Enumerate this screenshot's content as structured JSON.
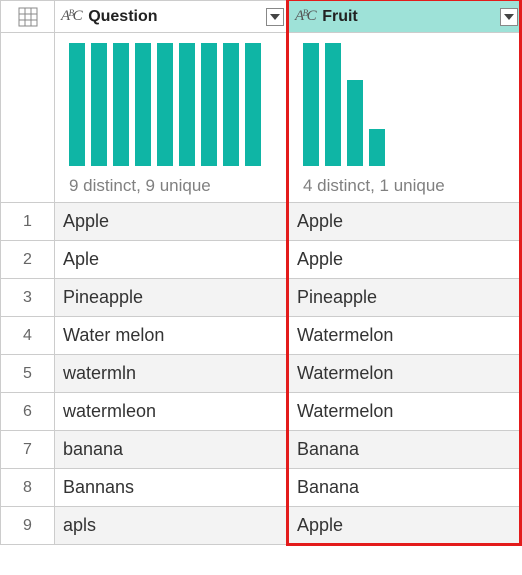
{
  "columns": [
    {
      "name": "Question",
      "type_prefix": "ABC",
      "selected": false,
      "stats_label": "9 distinct, 9 unique",
      "bars": [
        100,
        100,
        100,
        100,
        100,
        100,
        100,
        100,
        100
      ]
    },
    {
      "name": "Fruit",
      "type_prefix": "ABC",
      "selected": true,
      "stats_label": "4 distinct, 1 unique",
      "bars": [
        100,
        100,
        70,
        30
      ]
    }
  ],
  "rows": [
    {
      "n": "1",
      "cells": [
        "Apple",
        "Apple"
      ]
    },
    {
      "n": "2",
      "cells": [
        "Aple",
        "Apple"
      ]
    },
    {
      "n": "3",
      "cells": [
        "Pineapple",
        "Pineapple"
      ]
    },
    {
      "n": "4",
      "cells": [
        "Water melon",
        "Watermelon"
      ]
    },
    {
      "n": "5",
      "cells": [
        "watermln",
        "Watermelon"
      ]
    },
    {
      "n": "6",
      "cells": [
        "watermleon",
        "Watermelon"
      ]
    },
    {
      "n": "7",
      "cells": [
        "banana",
        "Banana"
      ]
    },
    {
      "n": "8",
      "cells": [
        "Bannans",
        "Banana"
      ]
    },
    {
      "n": "9",
      "cells": [
        "apls",
        "Apple"
      ]
    }
  ],
  "chart_data": [
    {
      "type": "bar",
      "title": "Question value distribution",
      "categories": [
        "Apple",
        "Aple",
        "Pineapple",
        "Water melon",
        "watermln",
        "watermleon",
        "banana",
        "Bannans",
        "apls"
      ],
      "values": [
        1,
        1,
        1,
        1,
        1,
        1,
        1,
        1,
        1
      ],
      "summary": "9 distinct, 9 unique"
    },
    {
      "type": "bar",
      "title": "Fruit value distribution",
      "categories": [
        "Apple",
        "Watermelon",
        "Banana",
        "Pineapple"
      ],
      "values": [
        3,
        3,
        2,
        1
      ],
      "summary": "4 distinct, 1 unique"
    }
  ],
  "highlight_column_index": 1,
  "colors": {
    "accent": "#0fb5a5",
    "select": "#9ee2d8",
    "highlight": "#e31b1b"
  }
}
